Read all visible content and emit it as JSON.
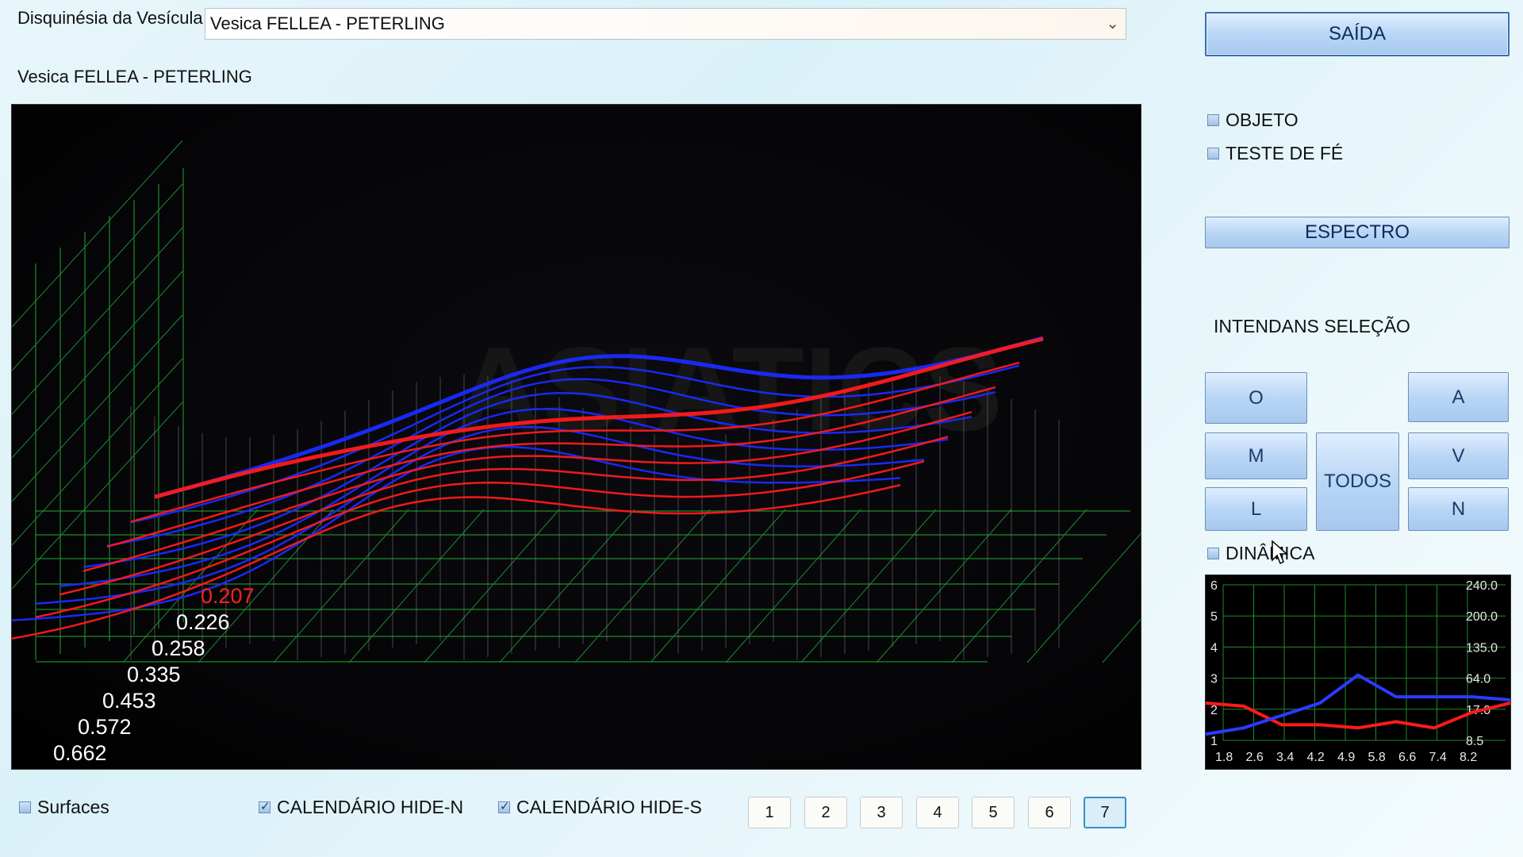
{
  "header": {
    "label": "Disquinésia da Vesícula I",
    "selected": "Vesica FELLEA - PETERLING",
    "subtitle": "Vesica FELLEA - PETERLING"
  },
  "sidebar": {
    "exit_button": "SAÍDA",
    "checkboxes": [
      {
        "label": "OBJETO",
        "checked": false
      },
      {
        "label": "TESTE DE FÉ",
        "checked": false
      }
    ],
    "spectrum_button": "ESPECTRO",
    "section_title": "INTENDANS SELEÇÃO",
    "buttons": {
      "o": "O",
      "a": "A",
      "m": "M",
      "todos": "TODOS",
      "v": "V",
      "l": "L",
      "n": "N"
    },
    "dynamic_label": "DINÂMICA",
    "dynamic_checked": false
  },
  "bottom": {
    "surfaces_label": "Surfaces",
    "surfaces_checked": false,
    "hide_n_label": "CALENDÁRIO HIDE-N",
    "hide_n_checked": true,
    "hide_s_label": "CALENDÁRIO HIDE-S",
    "hide_s_checked": true,
    "pages": [
      "1",
      "2",
      "3",
      "4",
      "5",
      "6",
      "7"
    ],
    "active_page": "7"
  },
  "chart_data": [
    {
      "type": "line",
      "title": "",
      "depth_labels": [
        "0.207",
        "0.226",
        "0.258",
        "0.335",
        "0.453",
        "0.572",
        "0.662"
      ],
      "highlight_depth_label": "0.207",
      "series_colors": {
        "red": "#ff1a1a",
        "blue": "#1a2bff",
        "grid": "#1f8a2a"
      },
      "watermark": "ASIATICS"
    },
    {
      "type": "line",
      "x_ticks": [
        "1.8",
        "2.6",
        "3.4",
        "4.2",
        "4.9",
        "5.8",
        "6.6",
        "7.4",
        "8.2"
      ],
      "y_left_ticks": [
        "6",
        "5",
        "4",
        "3",
        "2",
        "1"
      ],
      "y_right_ticks": [
        "240.0",
        "200.0",
        "135.0",
        "64.0",
        "17.0",
        "8.5"
      ],
      "series": [
        {
          "color": "#ff1a1a",
          "values": [
            2.2,
            2.1,
            1.5,
            1.5,
            1.4,
            1.6,
            1.4,
            1.9,
            2.2
          ]
        },
        {
          "color": "#2a3bff",
          "values": [
            1.2,
            1.4,
            1.8,
            2.2,
            3.1,
            2.4,
            2.4,
            2.4,
            2.3
          ]
        }
      ]
    }
  ]
}
